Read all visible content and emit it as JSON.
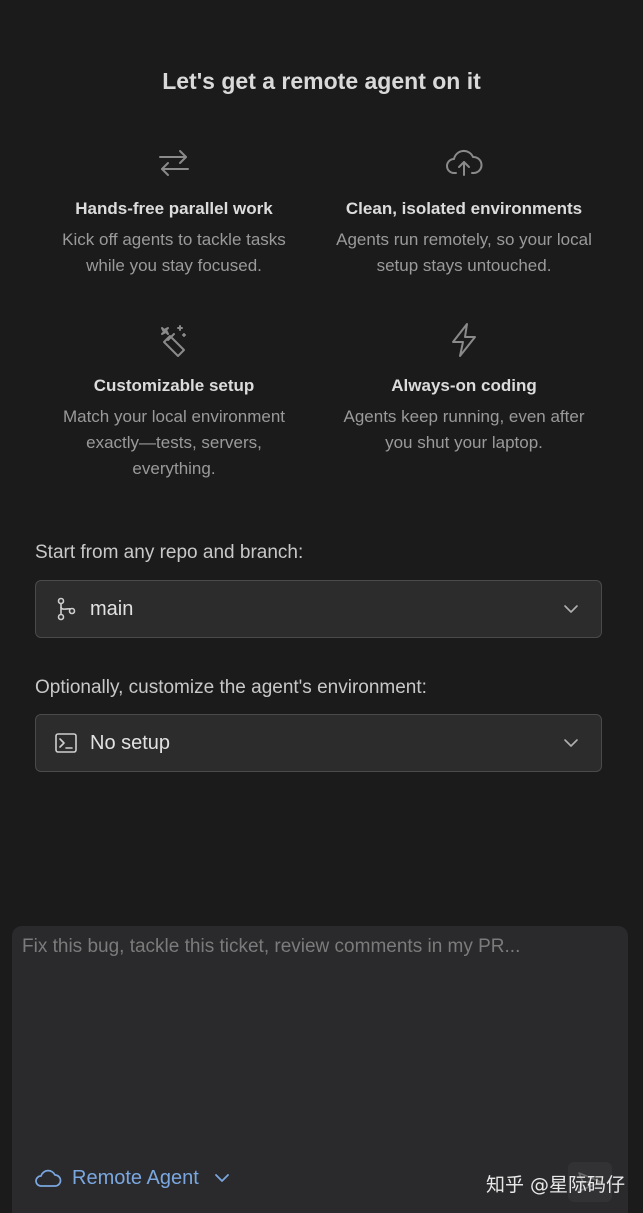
{
  "header": {
    "title": "Let's get a remote agent on it"
  },
  "features": [
    {
      "icon": "swap-arrows-icon",
      "title": "Hands-free parallel work",
      "description": "Kick off agents to tackle tasks while you stay focused."
    },
    {
      "icon": "cloud-upload-icon",
      "title": "Clean, isolated environments",
      "description": "Agents run remotely, so your local setup stays untouched."
    },
    {
      "icon": "magic-wand-icon",
      "title": "Customizable setup",
      "description": "Match your local environment exactly—tests, servers, everything."
    },
    {
      "icon": "lightning-icon",
      "title": "Always-on coding",
      "description": "Agents keep running, even after you shut your laptop."
    }
  ],
  "repo": {
    "label": "Start from any repo and branch:",
    "selected": "main",
    "icon": "git-branch-icon"
  },
  "environment": {
    "label": "Optionally, customize the agent's environment:",
    "selected": "No setup",
    "icon": "terminal-icon"
  },
  "composer": {
    "placeholder": "Fix this bug, tackle this ticket, review comments in my PR...",
    "value": "",
    "agent_label": "Remote Agent",
    "watermark": "知乎 @星际码仔"
  },
  "colors": {
    "background": "#1b1b1b",
    "accent": "#7aa7e0",
    "select_bg": "#2c2c2c",
    "composer_bg": "#2a2a2c"
  }
}
